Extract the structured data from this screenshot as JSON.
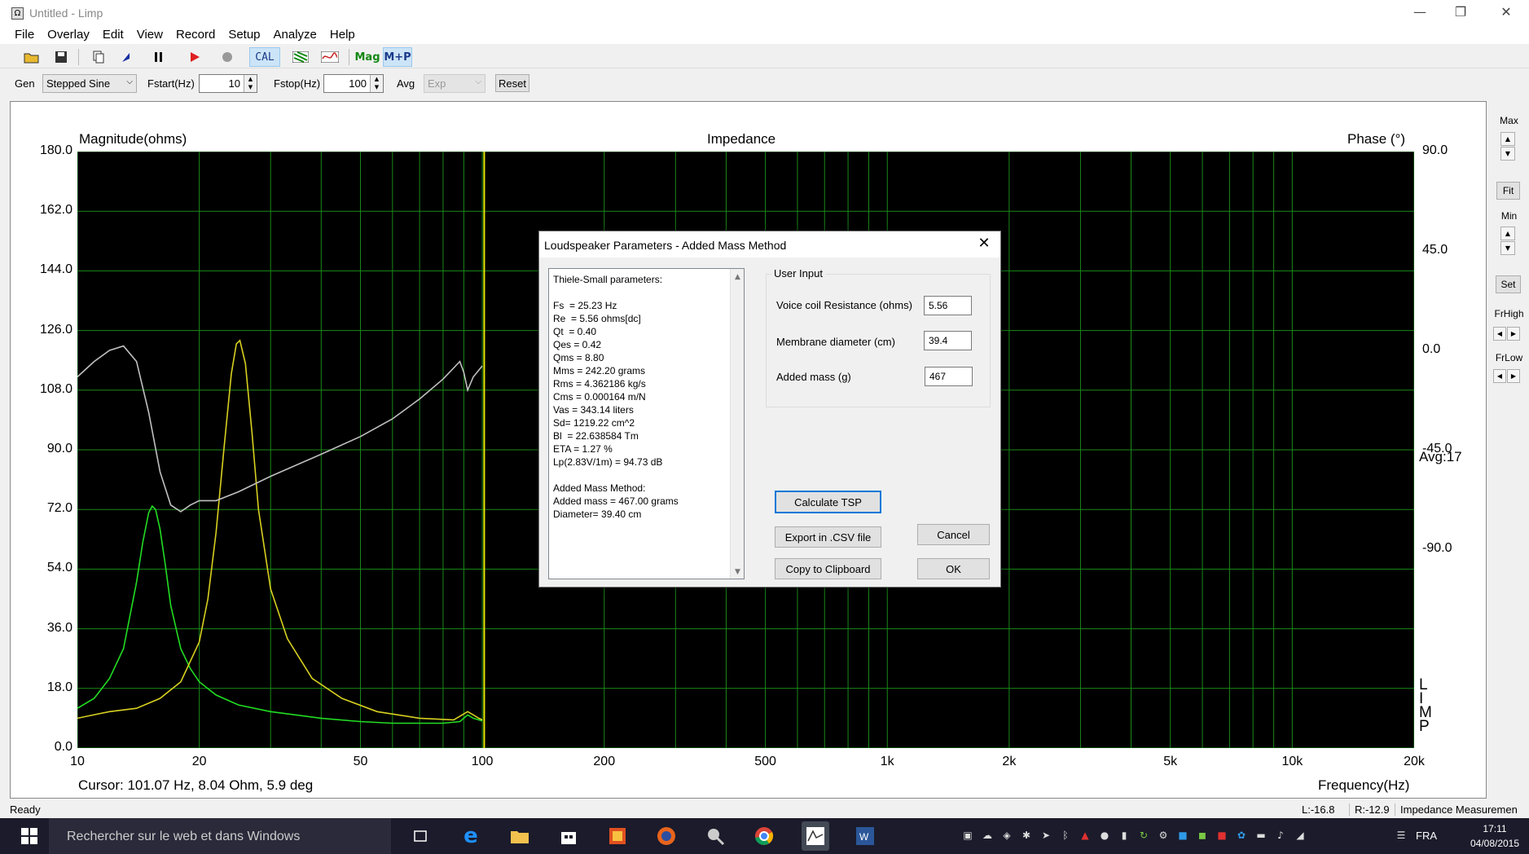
{
  "window": {
    "title": "Untitled - Limp",
    "app_icon_glyph": "Ω",
    "minimize_glyph": "—",
    "maximize_glyph": "❐",
    "close_glyph": "✕"
  },
  "menu": [
    "File",
    "Overlay",
    "Edit",
    "View",
    "Record",
    "Setup",
    "Analyze",
    "Help"
  ],
  "toolbar": {
    "cal_label": "CAL",
    "mag_label": "Mag",
    "mp_label": "M+P"
  },
  "controls": {
    "gen_label": "Gen",
    "gen_value": "Stepped Sine",
    "fstart_label": "Fstart(Hz)",
    "fstart_value": "10",
    "fstop_label": "Fstop(Hz)",
    "fstop_value": "100",
    "avg_label": "Avg",
    "avg_value": "Exp",
    "reset_label": "Reset"
  },
  "plot": {
    "title": "Impedance",
    "left_axis_title": "Magnitude(ohms)",
    "right_axis_title": "Phase (°)",
    "x_axis_title": "Frequency(Hz)",
    "cursor_text": "Cursor: 101.07 Hz, 8.04 Ohm, 5.9 deg",
    "avg_text": "Avg:17",
    "watermark": [
      "L",
      "I",
      "M",
      "P"
    ],
    "colors": {
      "background": "#000000",
      "grid": "#1a8a1a",
      "green_trace": "#22dd22",
      "yellow_trace": "#d8d020",
      "gray_trace": "#c0c0c0",
      "cursor": "#e8e800"
    }
  },
  "right_panel": {
    "max_label": "Max",
    "fit_label": "Fit",
    "min_label": "Min",
    "set_label": "Set",
    "frhigh_label": "FrHigh",
    "frlow_label": "FrLow"
  },
  "status": {
    "left": "Ready",
    "l_value": "L:-16.8",
    "r_value": "R:-12.9",
    "mode": "Impedance Measuremen"
  },
  "taskbar": {
    "search_placeholder": "Rechercher sur le web et dans Windows",
    "language": "FRA",
    "time": "17:11",
    "date": "04/08/2015"
  },
  "dialog": {
    "title": "Loudspeaker Parameters - Added Mass Method",
    "ts_lines": [
      "Thiele-Small parameters:",
      "",
      "Fs  = 25.23 Hz",
      "Re  = 5.56 ohms[dc]",
      "Qt  = 0.40",
      "Qes = 0.42",
      "Qms = 8.80",
      "Mms = 242.20 grams",
      "Rms = 4.362186 kg/s",
      "Cms = 0.000164 m/N",
      "Vas = 343.14 liters",
      "Sd= 1219.22 cm^2",
      "Bl  = 22.638584 Tm",
      "ETA = 1.27 %",
      "Lp(2.83V/1m) = 94.73 dB",
      "",
      "Added Mass Method:",
      "Added mass = 467.00 grams",
      "Diameter= 39.40 cm"
    ],
    "user_input_legend": "User Input",
    "voice_coil_label": "Voice coil Resistance (ohms)",
    "voice_coil_value": "5.56",
    "membrane_label": "Membrane diameter (cm)",
    "membrane_value": "39.4",
    "added_mass_label": "Added mass (g)",
    "added_mass_value": "467",
    "calculate_label": "Calculate TSP",
    "export_label": "Export in .CSV file",
    "copy_label": "Copy to Clipboard",
    "cancel_label": "Cancel",
    "ok_label": "OK"
  },
  "chart_data": {
    "type": "line",
    "title": "Impedance",
    "xlabel": "Frequency(Hz)",
    "ylabel": "Magnitude(ohms)",
    "y2label": "Phase (°)",
    "xscale": "log",
    "xlim": [
      10,
      20000
    ],
    "ylim": [
      0,
      180
    ],
    "y2lim": [
      -180,
      90
    ],
    "x_tick_labels": [
      "10",
      "20",
      "50",
      "100",
      "200",
      "500",
      "1k",
      "2k",
      "5k",
      "10k",
      "20k"
    ],
    "x_tick_values": [
      10,
      20,
      50,
      100,
      200,
      500,
      1000,
      2000,
      5000,
      10000,
      20000
    ],
    "y_tick_labels": [
      "180.0",
      "162.0",
      "144.0",
      "126.0",
      "108.0",
      "90.0",
      "72.0",
      "54.0",
      "36.0",
      "18.0",
      "0.0"
    ],
    "y2_tick_labels": [
      "90.0",
      "45.0",
      "0.0",
      "-45.0",
      "-90.0"
    ],
    "y2_tick_values": [
      90,
      45,
      0,
      -45,
      -90
    ],
    "grid": true,
    "cursor_x": 101.07,
    "series": [
      {
        "color": "#22dd22",
        "x": [
          10,
          11,
          12,
          13,
          14,
          14.5,
          15,
          15.3,
          15.6,
          16,
          16.5,
          17,
          18,
          19,
          20,
          22,
          25,
          30,
          40,
          50,
          60,
          70,
          80,
          88,
          92,
          95,
          98,
          100
        ],
        "y": [
          12,
          15,
          21,
          30,
          50,
          62,
          71,
          73,
          72,
          66,
          55,
          43,
          30,
          24,
          20,
          16,
          13,
          11,
          9,
          8,
          7.5,
          7.5,
          7.5,
          8,
          10,
          9,
          8.5,
          8.2
        ]
      },
      {
        "color": "#d8d020",
        "x": [
          10,
          12,
          14,
          16,
          18,
          20,
          21,
          22,
          23,
          24,
          24.7,
          25.2,
          26,
          27,
          28,
          30,
          33,
          38,
          45,
          55,
          70,
          85,
          92,
          95,
          98,
          100
        ],
        "y": [
          9,
          11,
          12,
          15,
          20,
          32,
          45,
          65,
          90,
          113,
          122,
          123,
          116,
          95,
          72,
          48,
          33,
          21,
          15,
          11,
          9,
          8.5,
          11,
          10,
          9,
          8.5
        ]
      },
      {
        "color": "#c0c0c0",
        "x": [
          10,
          11,
          12,
          13,
          14,
          15,
          16,
          17,
          18,
          19,
          20,
          22,
          25,
          30,
          40,
          50,
          60,
          70,
          80,
          88,
          90,
          92,
          95,
          100
        ],
        "y": [
          -12,
          -5,
          0,
          2,
          -5,
          -28,
          -55,
          -70,
          -73,
          -70,
          -68,
          -68,
          -64,
          -57,
          -47,
          -39,
          -31,
          -22,
          -13,
          -5,
          -10,
          -18,
          -12,
          -7
        ]
      }
    ]
  }
}
